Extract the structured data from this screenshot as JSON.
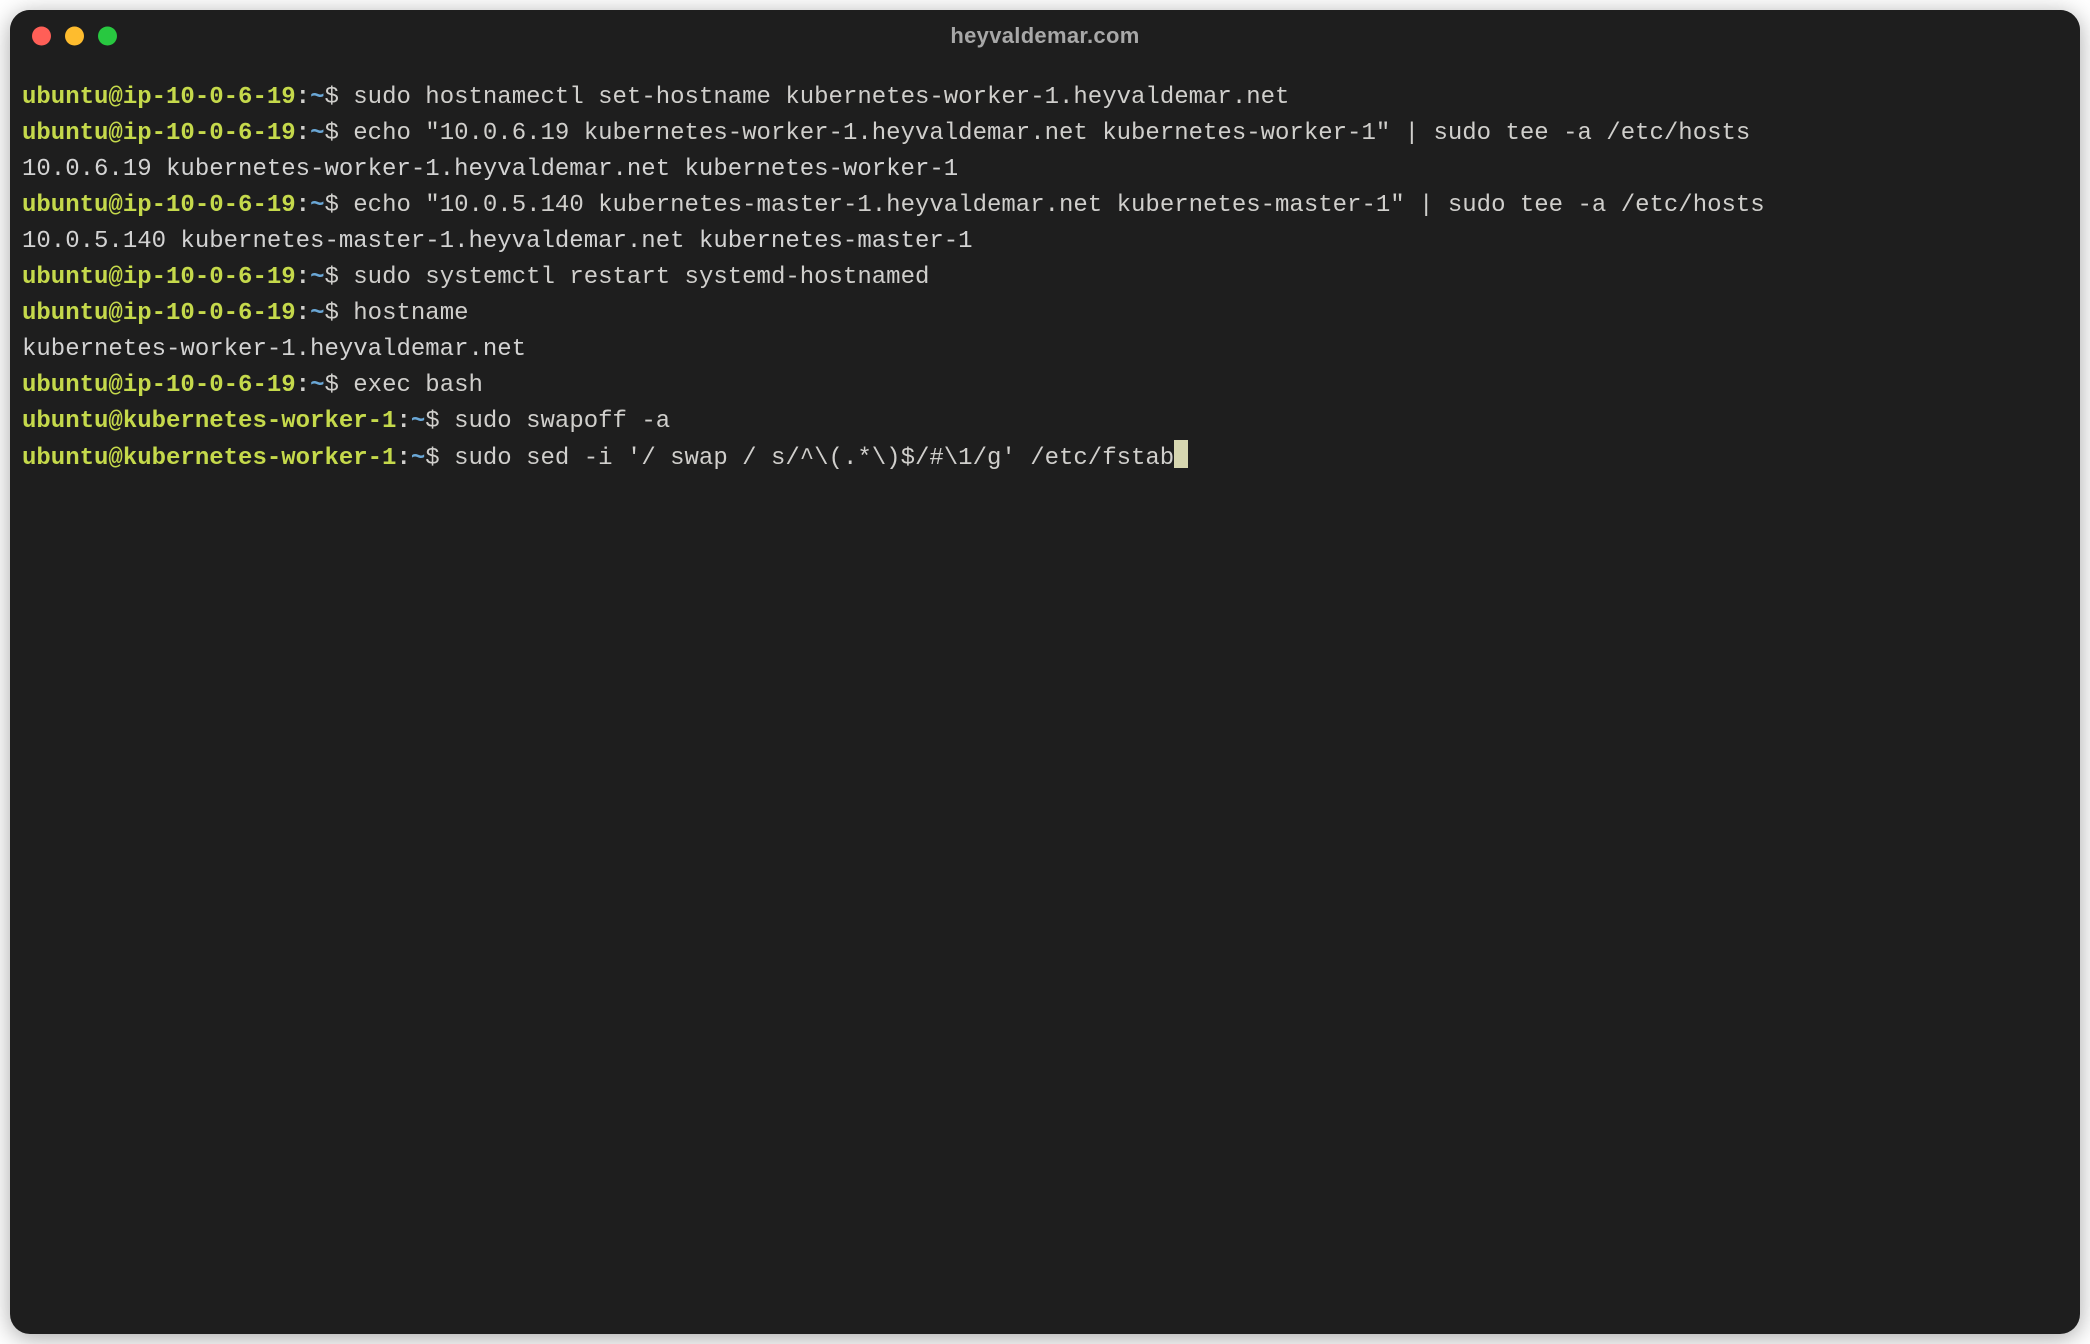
{
  "window": {
    "title": "heyvaldemar.com"
  },
  "colors": {
    "bg": "#1e1e1e",
    "fg": "#d0cfcc",
    "user_host": "#c5d94b",
    "path": "#6aa7d6",
    "traffic_red": "#ff5f57",
    "traffic_yellow": "#febc2e",
    "traffic_green": "#28c840"
  },
  "prompt_template": {
    "colon": ":",
    "path": "~",
    "dollar": "$"
  },
  "lines": [
    {
      "type": "cmd",
      "user_host": "ubuntu@ip-10-0-6-19",
      "command": "sudo hostnamectl set-hostname kubernetes-worker-1.heyvaldemar.net"
    },
    {
      "type": "cmd",
      "user_host": "ubuntu@ip-10-0-6-19",
      "command": "echo \"10.0.6.19 kubernetes-worker-1.heyvaldemar.net kubernetes-worker-1\" | sudo tee -a /etc/hosts"
    },
    {
      "type": "out",
      "text": "10.0.6.19 kubernetes-worker-1.heyvaldemar.net kubernetes-worker-1"
    },
    {
      "type": "cmd",
      "user_host": "ubuntu@ip-10-0-6-19",
      "command": "echo \"10.0.5.140 kubernetes-master-1.heyvaldemar.net kubernetes-master-1\" | sudo tee -a /etc/hosts"
    },
    {
      "type": "out",
      "text": "10.0.5.140 kubernetes-master-1.heyvaldemar.net kubernetes-master-1"
    },
    {
      "type": "cmd",
      "user_host": "ubuntu@ip-10-0-6-19",
      "command": "sudo systemctl restart systemd-hostnamed"
    },
    {
      "type": "cmd",
      "user_host": "ubuntu@ip-10-0-6-19",
      "command": "hostname"
    },
    {
      "type": "out",
      "text": "kubernetes-worker-1.heyvaldemar.net"
    },
    {
      "type": "cmd",
      "user_host": "ubuntu@ip-10-0-6-19",
      "command": "exec bash"
    },
    {
      "type": "cmd",
      "user_host": "ubuntu@kubernetes-worker-1",
      "command": "sudo swapoff -a"
    },
    {
      "type": "cmd",
      "user_host": "ubuntu@kubernetes-worker-1",
      "command": "sudo sed -i '/ swap / s/^\\(.*\\)$/#\\1/g' /etc/fstab",
      "cursor": true
    }
  ]
}
